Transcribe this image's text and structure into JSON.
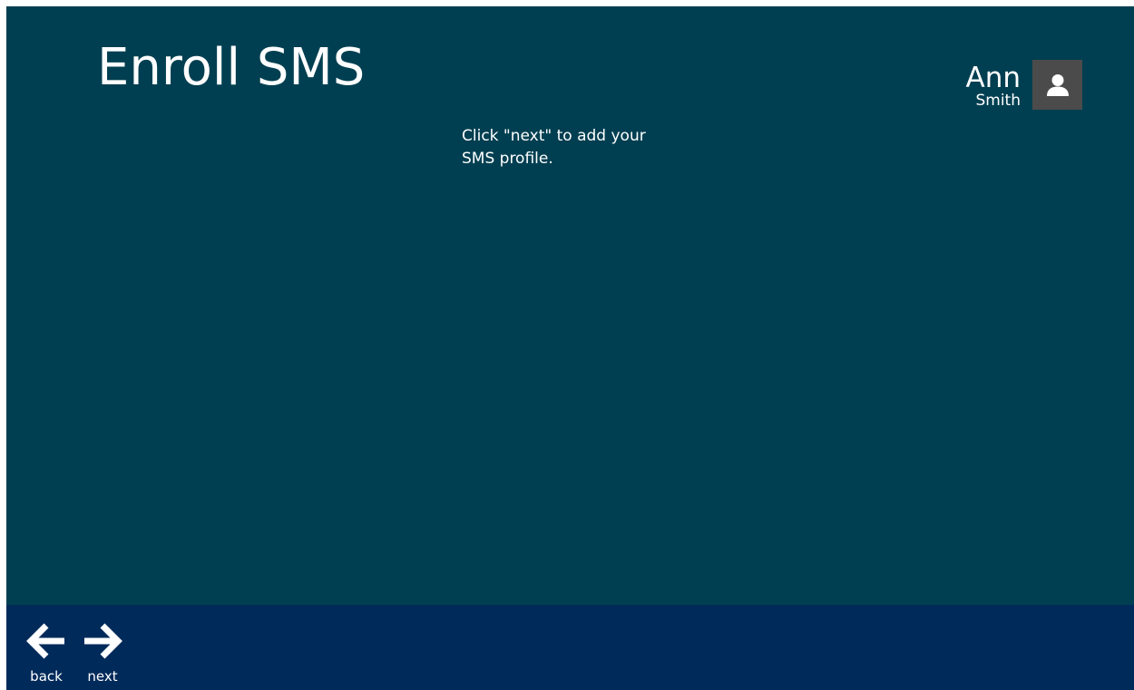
{
  "page": {
    "title": "Enroll SMS",
    "instruction": "Click \"next\" to add your SMS profile."
  },
  "user": {
    "first_name": "Ann",
    "last_name": "Smith",
    "avatar_icon": "user-icon"
  },
  "app_bar": {
    "back": {
      "label": "back",
      "icon": "arrow-left-icon"
    },
    "next": {
      "label": "next",
      "icon": "arrow-right-icon"
    }
  },
  "colors": {
    "background": "#003f51",
    "app_bar": "#002a5a",
    "avatar_bg": "#4b4b4b",
    "text": "#ffffff"
  }
}
